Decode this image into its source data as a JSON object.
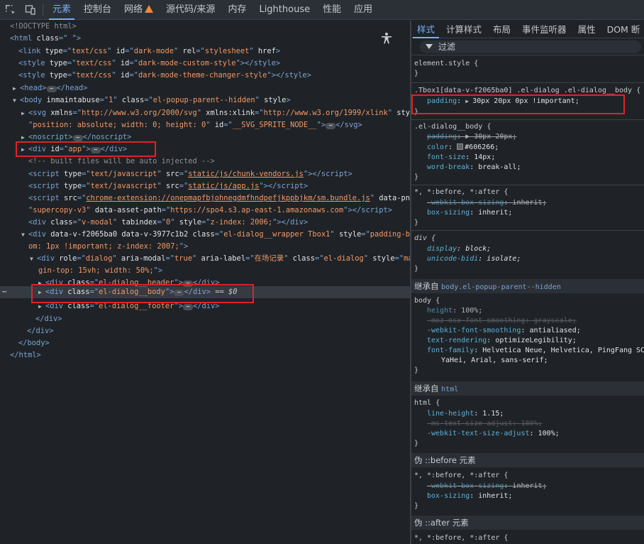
{
  "toolbar": {
    "tabs": [
      "元素",
      "控制台",
      "网络",
      "源代码/来源",
      "内存",
      "Lighthouse",
      "性能",
      "应用"
    ]
  },
  "dom": {
    "l0": "<!DOCTYPE html>",
    "html_open": "<html class=\" \">",
    "link_line": [
      "<link ",
      "type",
      "=\"",
      "text/css",
      "\" ",
      "id",
      "=\"",
      "dark-mode",
      "\" ",
      "rel",
      "=\"",
      "stylesheet",
      "\" ",
      "href",
      ">"
    ],
    "style1": "dark-mode-custom-style",
    "style2": "dark-mode-theme-changer-style",
    "head": "head",
    "body_attrs": {
      "inmaintabuse": "1",
      "class": "el-popup-parent--hidden"
    },
    "svg_xmlns": "http://www.w3.org/2000/svg",
    "svg_xlink": "http://www.w3.org/1999/xlink",
    "svg_style": "position: absolute; width: 0; height: 0",
    "svg_id": "__SVG_SPRITE_NODE__",
    "app_id": "app",
    "comment": "<!-- built files will be auto injected -->",
    "script1": "static/js/chunk-vendors.js",
    "script2": "static/js/app.js",
    "script3": "chrome-extension://onepmapfbjohnegdmfhndpefjkppbjkm/sm.bundle.js",
    "pname": "supercopy-v3",
    "asset_path": "https://spo4.s3.ap-east-1.amazonaws.com",
    "vmodal_style": "z-index: 2006;",
    "wrapper_attrs": "data-v-f2065ba0 data-v-3977c1b2",
    "wrapper_class": "el-dialog__wrapper Tbox1",
    "wrapper_style_a": "padding-bott",
    "wrapper_style_b": "om: 1px !important; z-index: 2007;",
    "dialog_label": "在场记录",
    "dialog_style_a": "mar",
    "dialog_style_b": "gin-top: 15vh; width: 50%;",
    "header_class": "el-dialog__header",
    "body_class": "el-dialog__body",
    "footer_class": "el-dialog__footer",
    "selected_suffix": "== $0"
  },
  "styles": {
    "tabs": [
      "样式",
      "计算样式",
      "布局",
      "事件监听器",
      "属性",
      "DOM 断"
    ],
    "filter_label": "过滤",
    "element_style": "element.style {",
    "rule1_selector": ".Tbox1[data-v-f2065ba0] .el-dialog .el-dialog__body {",
    "rule1_padding": "30px 20px 0px !important;",
    "rule2_selector": ".el-dialog__body {",
    "rule2_padding": "30px 20px;",
    "rule2_color": "#606266;",
    "rule2_font_size": "14px;",
    "rule2_word_break": "break-all;",
    "rule3_selector": "*, *:before, *:after {",
    "rule3_webkit": "inherit;",
    "rule3_box": "inherit;",
    "div_selector": "div {",
    "div_display": "block;",
    "div_unicode": "isolate;",
    "inherit1_label": "继承自",
    "inherit1_ref": "body.el-popup-parent--hidden",
    "body_selector": "body {",
    "body_height": "100%;",
    "body_moz": "grayscale;",
    "body_webkit": "antialiased;",
    "body_text_rendering": "optimizeLegibility;",
    "body_font_family_a": "Helvetica Neue, Helvetica, PingFang SC",
    "body_font_family_b": "YaHei, Arial, sans-serif;",
    "inherit2_ref": "html",
    "html_selector": "html {",
    "html_line_height": "1.15;",
    "html_ms": "100%;",
    "html_webkit": "100%;",
    "pseudo_before": "伪 ::before 元素",
    "pseudo_after": "伪 ::after 元素",
    "pseudo_selector": "*, *:before, *:after {",
    "close_brace": "}"
  }
}
